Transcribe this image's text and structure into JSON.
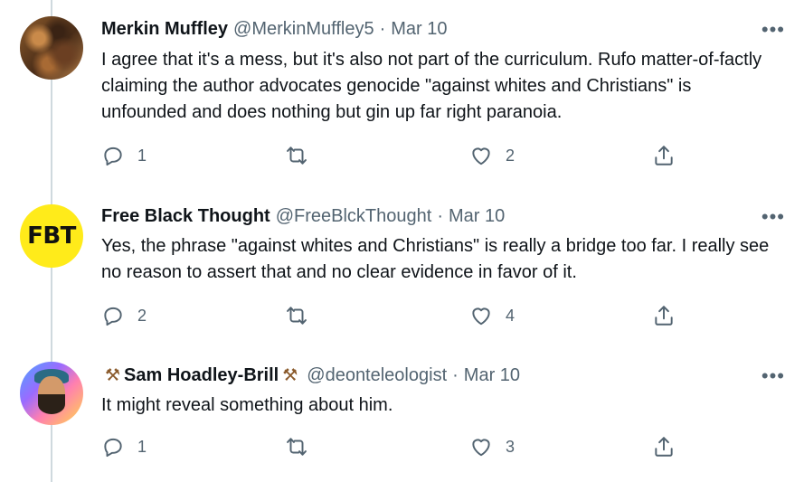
{
  "tweets": [
    {
      "name": "Merkin Muffley",
      "handle": "@MerkinMuffley5",
      "dot": "·",
      "date": "Mar 10",
      "text": "I agree that it's a mess, but it's also not part of the curriculum. Rufo matter-of-factly claiming the author advocates genocide \"against whites and Christians\" is unfounded and does nothing but gin up far right paranoia.",
      "more": "•••",
      "reply_count": "1",
      "like_count": "2"
    },
    {
      "name": "Free Black Thought",
      "handle": "@FreeBlckThought",
      "dot": "·",
      "date": "Mar 10",
      "text": "Yes, the phrase \"against whites and Christians\" is really a bridge too far. I really see no reason to assert that and no clear evidence in favor of it.",
      "avatar_text": "FBT",
      "more": "•••",
      "reply_count": "2",
      "like_count": "4"
    },
    {
      "name": "Sam Hoadley-Brill",
      "name_emoji": "⚒",
      "handle": "@deonteleologist",
      "dot": "·",
      "date": "Mar 10",
      "text": "It might reveal something about him.",
      "more": "•••",
      "reply_count": "1",
      "like_count": "3"
    }
  ]
}
